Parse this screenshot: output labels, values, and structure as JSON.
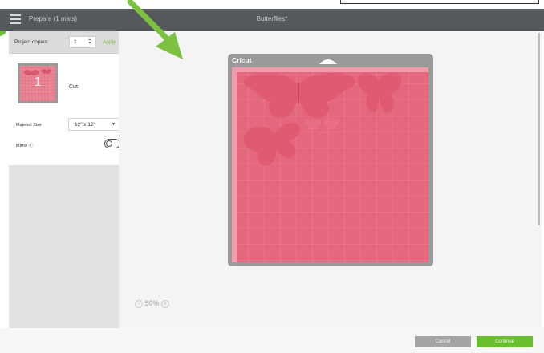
{
  "header": {
    "prepare_label": "Prepare (1 mats)",
    "title": "Butterflies*"
  },
  "left_panel": {
    "copies_label": "Project copies:",
    "copies_value": "1",
    "apply_label": "Apply",
    "mat": {
      "number": "1",
      "action_label": "Cut"
    },
    "material_size_label": "Material Size",
    "material_size_value": "12\" x 12\"",
    "mirror_label": "Mirror ⓘ",
    "mirror_on": false
  },
  "canvas": {
    "mat_brand": "Cricut",
    "zoom_label": "50%",
    "zoom_out_icon": "−",
    "zoom_in_icon": "+"
  },
  "footer": {
    "cancel_label": "Cancel",
    "continue_label": "Continue"
  },
  "colors": {
    "mat_pink": "#e4677d",
    "butterfly_pink": "#e05a71",
    "accent_green": "#6abf2e",
    "header_gray": "#55595c"
  }
}
